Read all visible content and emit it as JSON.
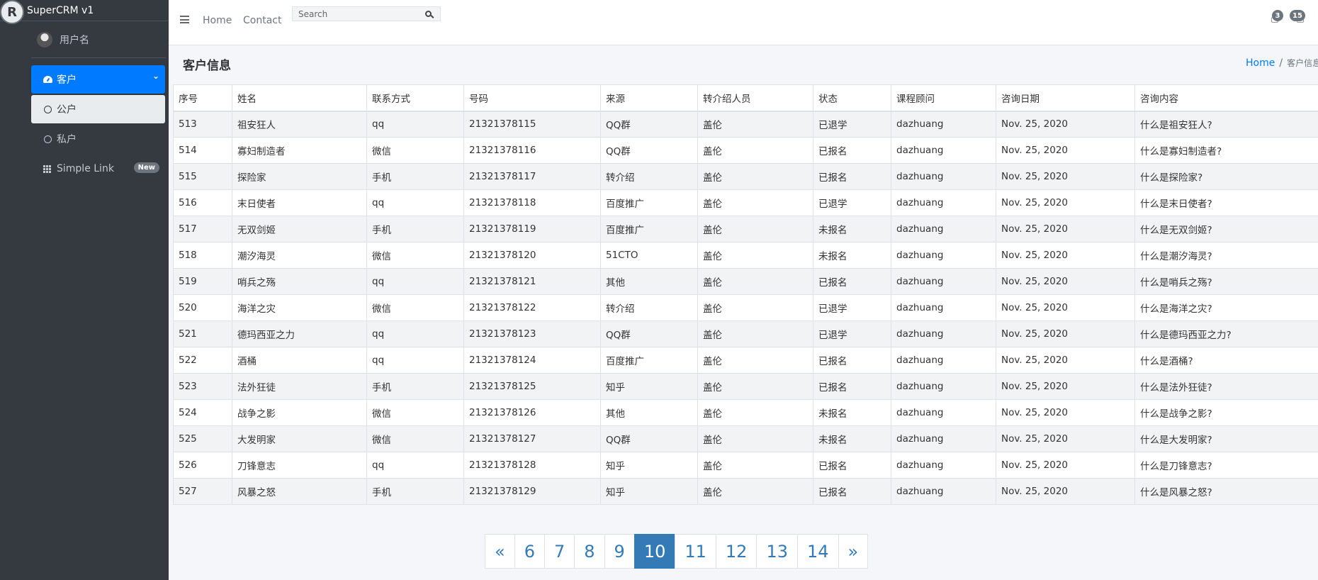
{
  "app": {
    "brand_name": "SuperCRM v1",
    "brand_logo_letter": "R"
  },
  "sidebar": {
    "user_name": "用户名",
    "items": [
      {
        "label": "客户",
        "icon": "gauge-icon",
        "state": "active",
        "expanded": true
      },
      {
        "label": "公户",
        "icon": "circle-icon",
        "state": "sub-active"
      },
      {
        "label": "私户",
        "icon": "circle-icon",
        "state": "normal"
      },
      {
        "label": "Simple Link",
        "icon": "grid-icon",
        "state": "normal",
        "badge": "New"
      }
    ]
  },
  "navbar": {
    "links": [
      "Home",
      "Contact"
    ],
    "search_placeholder": "Search",
    "notifications": {
      "messages": "3",
      "alerts": "15"
    }
  },
  "page": {
    "title": "客户信息",
    "breadcrumb": {
      "home": "Home",
      "separator": "/",
      "current": "客户信息"
    }
  },
  "table": {
    "columns": [
      "序号",
      "姓名",
      "联系方式",
      "号码",
      "来源",
      "转介绍人员",
      "状态",
      "课程顾问",
      "咨询日期",
      "咨询内容"
    ],
    "rows": [
      [
        "513",
        "祖安狂人",
        "qq",
        "21321378115",
        "QQ群",
        "盖伦",
        "已退学",
        "dazhuang",
        "Nov. 25, 2020",
        "什么是祖安狂人?"
      ],
      [
        "514",
        "寡妇制造者",
        "微信",
        "21321378116",
        "QQ群",
        "盖伦",
        "已报名",
        "dazhuang",
        "Nov. 25, 2020",
        "什么是寡妇制造者?"
      ],
      [
        "515",
        "探险家",
        "手机",
        "21321378117",
        "转介绍",
        "盖伦",
        "已报名",
        "dazhuang",
        "Nov. 25, 2020",
        "什么是探险家?"
      ],
      [
        "516",
        "末日使者",
        "qq",
        "21321378118",
        "百度推广",
        "盖伦",
        "已退学",
        "dazhuang",
        "Nov. 25, 2020",
        "什么是末日使者?"
      ],
      [
        "517",
        "无双剑姬",
        "手机",
        "21321378119",
        "百度推广",
        "盖伦",
        "未报名",
        "dazhuang",
        "Nov. 25, 2020",
        "什么是无双剑姬?"
      ],
      [
        "518",
        "潮汐海灵",
        "微信",
        "21321378120",
        "51CTO",
        "盖伦",
        "未报名",
        "dazhuang",
        "Nov. 25, 2020",
        "什么是潮汐海灵?"
      ],
      [
        "519",
        "哨兵之殇",
        "qq",
        "21321378121",
        "其他",
        "盖伦",
        "已报名",
        "dazhuang",
        "Nov. 25, 2020",
        "什么是哨兵之殇?"
      ],
      [
        "520",
        "海洋之灾",
        "微信",
        "21321378122",
        "转介绍",
        "盖伦",
        "已退学",
        "dazhuang",
        "Nov. 25, 2020",
        "什么是海洋之灾?"
      ],
      [
        "521",
        "德玛西亚之力",
        "qq",
        "21321378123",
        "QQ群",
        "盖伦",
        "已退学",
        "dazhuang",
        "Nov. 25, 2020",
        "什么是德玛西亚之力?"
      ],
      [
        "522",
        "酒桶",
        "qq",
        "21321378124",
        "百度推广",
        "盖伦",
        "已报名",
        "dazhuang",
        "Nov. 25, 2020",
        "什么是酒桶?"
      ],
      [
        "523",
        "法外狂徒",
        "手机",
        "21321378125",
        "知乎",
        "盖伦",
        "已报名",
        "dazhuang",
        "Nov. 25, 2020",
        "什么是法外狂徒?"
      ],
      [
        "524",
        "战争之影",
        "微信",
        "21321378126",
        "其他",
        "盖伦",
        "未报名",
        "dazhuang",
        "Nov. 25, 2020",
        "什么是战争之影?"
      ],
      [
        "525",
        "大发明家",
        "微信",
        "21321378127",
        "QQ群",
        "盖伦",
        "未报名",
        "dazhuang",
        "Nov. 25, 2020",
        "什么是大发明家?"
      ],
      [
        "526",
        "刀锋意志",
        "qq",
        "21321378128",
        "知乎",
        "盖伦",
        "已报名",
        "dazhuang",
        "Nov. 25, 2020",
        "什么是刀锋意志?"
      ],
      [
        "527",
        "风暴之怒",
        "手机",
        "21321378129",
        "知乎",
        "盖伦",
        "已报名",
        "dazhuang",
        "Nov. 25, 2020",
        "什么是风暴之怒?"
      ]
    ]
  },
  "pagination": {
    "prev": "«",
    "next": "»",
    "pages": [
      "6",
      "7",
      "8",
      "9",
      "10",
      "11",
      "12",
      "13",
      "14"
    ],
    "current": "10"
  },
  "colors": {
    "accent": "#007bff",
    "sidebar_bg": "#343a40",
    "pagination_active": "#337ab7"
  }
}
